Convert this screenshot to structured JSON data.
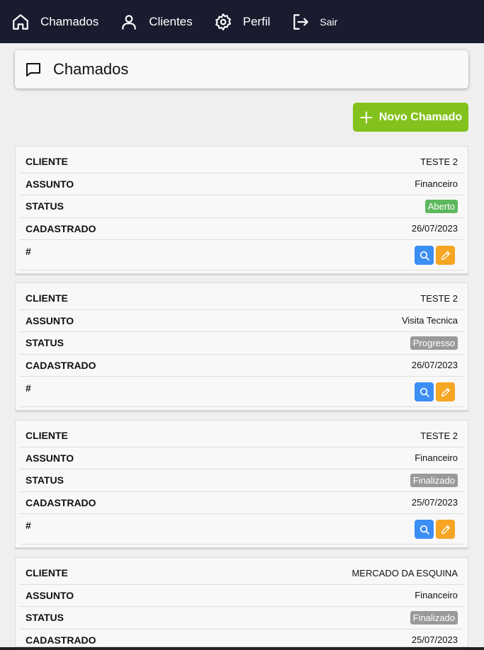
{
  "nav": {
    "items": [
      {
        "label": "Chamados",
        "icon": "home-icon"
      },
      {
        "label": "Clientes",
        "icon": "user-icon"
      },
      {
        "label": "Perfil",
        "icon": "gear-icon"
      },
      {
        "label": "Sair",
        "icon": "logout-icon"
      }
    ]
  },
  "page": {
    "title": "Chamados",
    "new_button": "Novo Chamado"
  },
  "labels": {
    "cliente": "CLIENTE",
    "assunto": "ASSUNTO",
    "status": "STATUS",
    "cadastrado": "CADASTRADO",
    "actions": "#"
  },
  "tickets": [
    {
      "cliente": "TESTE 2",
      "assunto": "Financeiro",
      "status": "Aberto",
      "cadastrado": "26/07/2023"
    },
    {
      "cliente": "TESTE 2",
      "assunto": "Visita Tecnica",
      "status": "Progresso",
      "cadastrado": "26/07/2023"
    },
    {
      "cliente": "TESTE 2",
      "assunto": "Financeiro",
      "status": "Finalizado",
      "cadastrado": "25/07/2023"
    },
    {
      "cliente": "MERCADO DA ESQUINA",
      "assunto": "Financeiro",
      "status": "Finalizado",
      "cadastrado": "25/07/2023"
    }
  ],
  "colors": {
    "navbar": "#181c2e",
    "new_button": "#83c21c",
    "status_aberto": "#5cb85c",
    "status_other": "#999999",
    "search_button": "#3b8ef3",
    "edit_button": "#f6a623"
  }
}
